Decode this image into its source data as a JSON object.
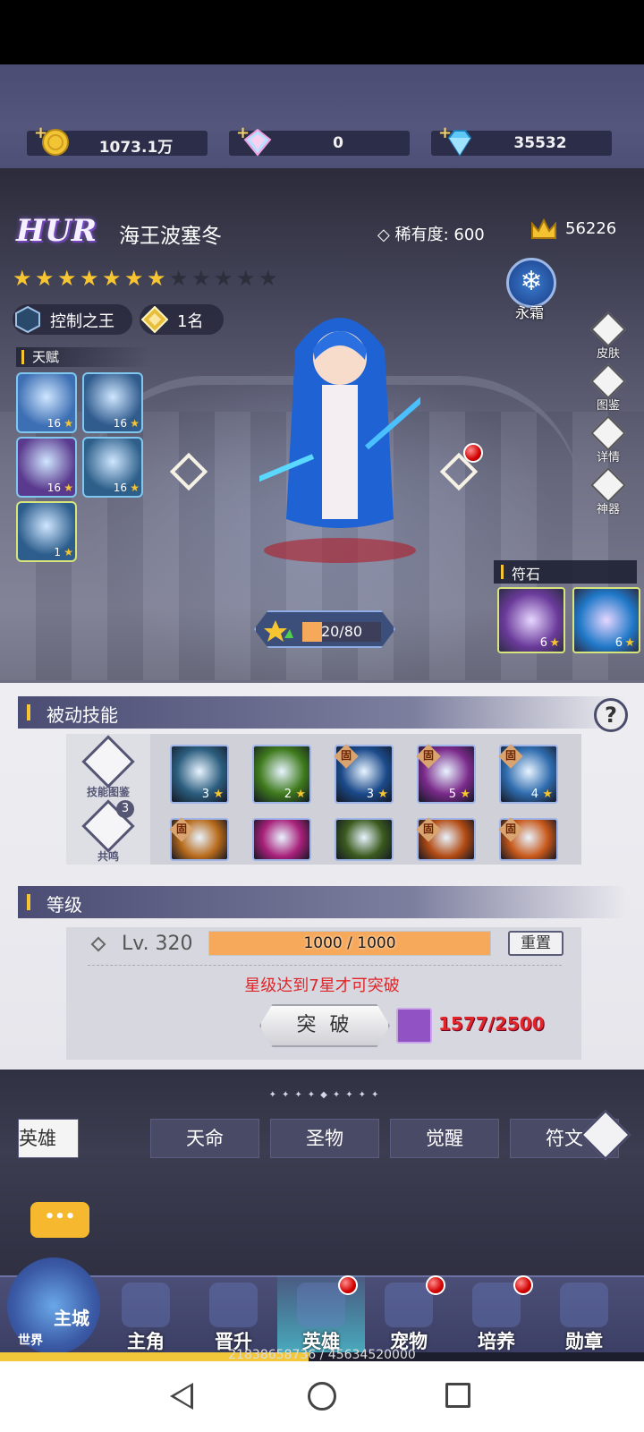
{
  "resources": [
    {
      "icon": "gold-coin-icon",
      "value": "1073.1万"
    },
    {
      "icon": "rainbow-gem-icon",
      "value": "0"
    },
    {
      "icon": "blue-diamond-icon",
      "value": "35532"
    }
  ],
  "hero": {
    "grade": "HUR",
    "name": "海王波塞冬",
    "rarity_label": "稀有度:",
    "rarity_value": "600",
    "power": "56226",
    "stars_filled": 7,
    "stars_total": 12,
    "title": "控制之王",
    "rank": "1名",
    "element_label": "永霜"
  },
  "talent": {
    "title": "天赋",
    "items": [
      {
        "level": "16",
        "color": "#3d6fb4"
      },
      {
        "level": "16",
        "color": "#2f5b8d"
      },
      {
        "level": "16",
        "color": "#5a3a8e"
      },
      {
        "level": "16",
        "color": "#2d5f8a"
      },
      {
        "level": "1",
        "color": "#2c5d8c"
      }
    ]
  },
  "side_menu": [
    {
      "label": "皮肤",
      "icon": "skin-icon"
    },
    {
      "label": "图鉴",
      "icon": "codex-icon"
    },
    {
      "label": "详情",
      "icon": "details-icon"
    },
    {
      "label": "神器",
      "icon": "artifact-icon"
    }
  ],
  "runestones": {
    "title": "符石",
    "items": [
      {
        "level": "6",
        "color": "#6a3a9a"
      },
      {
        "level": "6",
        "color": "#1f78c8"
      }
    ]
  },
  "exp": {
    "text": "20/80",
    "fraction": 0.25
  },
  "passive": {
    "title": "被动技能",
    "side_buttons": [
      {
        "label": "技能图鉴",
        "badge": ""
      },
      {
        "label": "共鸣",
        "badge": "3"
      }
    ],
    "row1": [
      {
        "level": "3",
        "fixed": false,
        "color": "#2b5d7e"
      },
      {
        "level": "2",
        "fixed": false,
        "color": "#3e7a1c"
      },
      {
        "level": "3",
        "fixed": true,
        "color": "#1b4a8a"
      },
      {
        "level": "5",
        "fixed": true,
        "color": "#7a2a8a"
      },
      {
        "level": "4",
        "fixed": true,
        "color": "#2f6cae"
      }
    ],
    "row2": [
      {
        "fixed": true,
        "color": "#b86a1a"
      },
      {
        "fixed": false,
        "color": "#a8207a"
      },
      {
        "fixed": false,
        "color": "#3b5a1e"
      },
      {
        "fixed": true,
        "color": "#b24a12"
      },
      {
        "fixed": true,
        "color": "#c8581a"
      }
    ],
    "fixed_tag": "固"
  },
  "level": {
    "title": "等级",
    "label": "Lv. 320",
    "bar_text": "1000 / 1000",
    "fraction": 1.0,
    "reset_label": "重置",
    "warning": "星级达到7星才可突破",
    "breakthrough_label": "突 破",
    "orb_count": "1577/2500"
  },
  "tabs": [
    {
      "label": "英雄",
      "active": true
    },
    {
      "label": "天命",
      "active": false
    },
    {
      "label": "圣物",
      "active": false
    },
    {
      "label": "觉醒",
      "active": false
    },
    {
      "label": "符文",
      "active": false
    }
  ],
  "nav": {
    "castle_label": "主城",
    "world_label": "世界",
    "items": [
      {
        "label": "主角",
        "badge": false,
        "active": false
      },
      {
        "label": "晋升",
        "badge": false,
        "active": false
      },
      {
        "label": "英雄",
        "badge": true,
        "active": true
      },
      {
        "label": "宠物",
        "badge": true,
        "active": false
      },
      {
        "label": "培养",
        "badge": true,
        "active": false
      },
      {
        "label": "勋章",
        "badge": false,
        "active": false
      }
    ]
  },
  "progress": {
    "text": "21838658736 / 45634520000",
    "fraction": 0.4785
  }
}
